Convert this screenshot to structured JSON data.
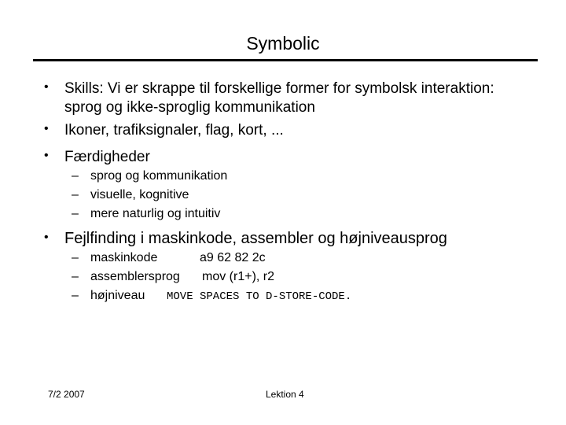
{
  "slide": {
    "title": "Symbolic",
    "bullets": [
      {
        "line1": "Skills: Vi er skrappe til forskellige former for symbolsk interaktion:",
        "line2": "sprog og ikke-sproglig kommunikation"
      },
      {
        "line1": "Ikoner, trafiksignaler, flag, kort, ..."
      },
      {
        "line1": "Færdigheder",
        "subitems": [
          "sprog og kommunikation",
          "visuelle, kognitive",
          "mere naturlig og intuitiv"
        ]
      },
      {
        "line1": "Fejlfinding i maskinkode, assembler og højniveausprog",
        "subitems": [
          {
            "label": "maskinkode",
            "code": "a9 62 82 2c"
          },
          {
            "label": "assemblersprog",
            "code": "mov (r1+), r2"
          },
          {
            "label": "højniveau",
            "code": "MOVE SPACES TO D-STORE-CODE."
          }
        ]
      }
    ],
    "bullet_glyph": "•",
    "dash_glyph": "–"
  },
  "footer": {
    "date": "7/2 2007",
    "center": "Lektion 4"
  }
}
